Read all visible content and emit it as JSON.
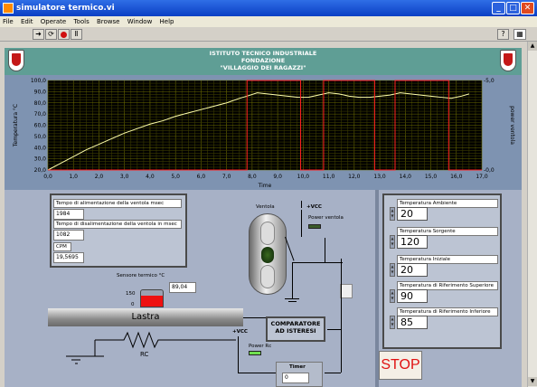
{
  "window": {
    "title": "simulatore termico.vi",
    "minimize": "_",
    "maximize": "□",
    "close": "✕"
  },
  "menu": [
    "File",
    "Edit",
    "Operate",
    "Tools",
    "Browse",
    "Window",
    "Help"
  ],
  "toolbar": {
    "run_icon": "run-arrow-icon",
    "run_continuous_icon": "run-continuously-icon",
    "abort_icon": "abort-icon",
    "pause_icon": "pause-icon",
    "help_icon": "help-icon",
    "panel_icon": "vi-icon"
  },
  "header": {
    "lines": [
      "ISTITUTO TECNICO INDUSTRIALE",
      "FONDAZIONE",
      "\"VILLAGGIO DEI RAGAZZI\""
    ]
  },
  "chart_data": {
    "type": "line",
    "xlabel": "Time",
    "ylabel": "Temperatura °C",
    "y2label": "power ventola",
    "xlim": [
      0.0,
      17.0
    ],
    "ylim": [
      20.0,
      100.0
    ],
    "y2lim": [
      0.0,
      5.0
    ],
    "x_ticks": [
      "0,0",
      "1,0",
      "2,0",
      "3,0",
      "4,0",
      "5,0",
      "6,0",
      "7,0",
      "8,0",
      "9,0",
      "10,0",
      "11,0",
      "12,0",
      "13,0",
      "14,0",
      "15,0",
      "16,0",
      "17,0"
    ],
    "y_ticks": [
      "20,0",
      "30,0",
      "40,0",
      "50,0",
      "60,0",
      "70,0",
      "80,0",
      "90,0",
      "100,0"
    ],
    "y2_ticks": [
      "0,0",
      "5,0"
    ],
    "grid": true,
    "series": [
      {
        "color": "#ffffaa",
        "x": [
          0,
          0.5,
          1,
          1.5,
          2,
          2.5,
          3,
          3.5,
          4,
          4.5,
          5,
          5.5,
          6,
          6.5,
          7,
          7.5,
          7.8,
          8.2,
          8.6,
          9,
          9.4,
          9.8,
          10.2,
          10.6,
          11,
          11.4,
          11.8,
          12.2,
          12.6,
          13,
          13.4,
          13.8,
          14.2,
          14.6,
          15,
          15.4,
          15.8,
          16.2,
          16.5
        ],
        "y": [
          20,
          26,
          32,
          38,
          43,
          48,
          53,
          57,
          61,
          64,
          68,
          71,
          74,
          77,
          80,
          84,
          86,
          89,
          88,
          87,
          86,
          85,
          85,
          87,
          89,
          88,
          86,
          85,
          85,
          86,
          87,
          89,
          88,
          87,
          86,
          85,
          84,
          86,
          88
        ]
      },
      {
        "color": "#ff2020",
        "x": [
          0,
          7.8,
          7.8,
          9.9,
          9.9,
          10.8,
          10.8,
          12.8,
          12.8,
          13.6,
          13.6,
          15.7,
          15.7,
          17
        ],
        "y": [
          0,
          0,
          5,
          5,
          0,
          0,
          5,
          5,
          0,
          0,
          5,
          5,
          0,
          0
        ],
        "axis": "right"
      }
    ]
  },
  "panel": {
    "fields": [
      {
        "label": "Tempo di alimentazione della ventola msec",
        "value": "1984"
      },
      {
        "label": "Tempo di disalimentazione della ventola in msec",
        "value": "1082"
      },
      {
        "label": "CPM",
        "value": "19,5695"
      }
    ],
    "ventola_label": "Ventola",
    "vcc_label": "+VCC",
    "power_ventola_label": "Power ventola",
    "sensor": {
      "label": "Sensore termico °C",
      "value": "89,04",
      "scale_high": "150",
      "scale_low": "0",
      "level": 0.59
    },
    "lastra_label": "Lastra",
    "rc_label": "RC",
    "comparatore_label": "COMPARATORE AD ISTERESI",
    "vcc2_label": "+VCC",
    "power_rc_label": "Power Rc",
    "timer": {
      "label": "Timer",
      "value": "0"
    },
    "stop_label": "STOP"
  },
  "controls": [
    {
      "label": "Temperatura Ambiente",
      "value": "20"
    },
    {
      "label": "Temperatura Sorgente",
      "value": "120"
    },
    {
      "label": "Temperatura Iniziale",
      "value": "20"
    },
    {
      "label": "Temperatura di Riferimento Superiore",
      "value": "90"
    },
    {
      "label": "Temperatura di Riferimento Inferiore",
      "value": "85"
    }
  ]
}
